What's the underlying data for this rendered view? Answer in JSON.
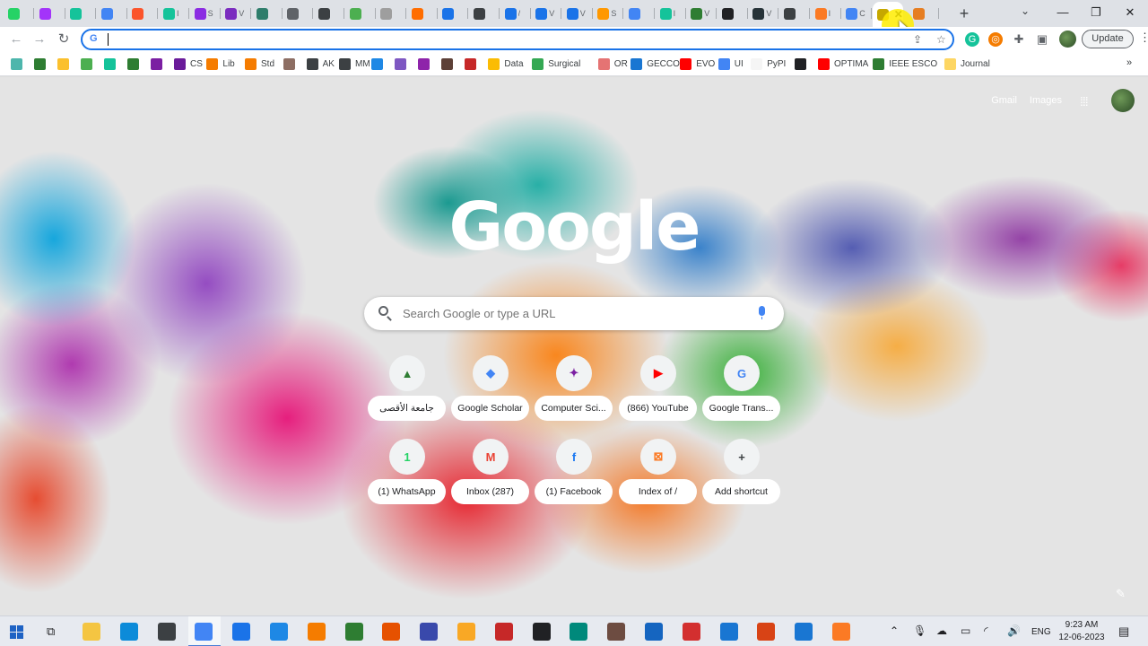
{
  "tabs": [
    {
      "icon": "whatsapp-icon",
      "label": "",
      "color": "#25d366"
    },
    {
      "icon": "messenger-icon",
      "label": "",
      "color": "#a334fa"
    },
    {
      "icon": "grammarly-icon",
      "label": "",
      "color": "#15c39a"
    },
    {
      "icon": "translate-icon",
      "label": "",
      "color": "#4285f4"
    },
    {
      "icon": "brave-icon",
      "label": "",
      "color": "#fb542b"
    },
    {
      "icon": "grammarly-icon",
      "label": "I",
      "color": "#15c39a"
    },
    {
      "icon": "p-icon",
      "label": "S",
      "color": "#8a2be2"
    },
    {
      "icon": "w-icon",
      "label": "V",
      "color": "#7a2cbf"
    },
    {
      "icon": "music-icon",
      "label": "",
      "color": "#2e7d6b"
    },
    {
      "icon": "arrow-icon",
      "label": "",
      "color": "#5f6368"
    },
    {
      "icon": "tool-icon",
      "label": "",
      "color": "#3c4043"
    },
    {
      "icon": "leaf-icon",
      "label": "",
      "color": "#4caf50"
    },
    {
      "icon": "e-icon",
      "label": "",
      "color": "#9e9e9e"
    },
    {
      "icon": "orange-icon",
      "label": "",
      "color": "#ff6d00"
    },
    {
      "icon": "doc-icon",
      "label": "",
      "color": "#1a73e8"
    },
    {
      "icon": "github-icon",
      "label": "",
      "color": "#3c4043"
    },
    {
      "icon": "copyright-icon",
      "label": "/",
      "color": "#1a73e8"
    },
    {
      "icon": "robot-icon",
      "label": "V",
      "color": "#1a73e8"
    },
    {
      "icon": "robot-icon",
      "label": "V",
      "color": "#1a73e8"
    },
    {
      "icon": "fish-icon",
      "label": "S",
      "color": "#ff9800"
    },
    {
      "icon": "google-icon",
      "label": "",
      "color": "#4285f4"
    },
    {
      "icon": "grammarly-icon",
      "label": "I",
      "color": "#15c39a"
    },
    {
      "icon": "w-icon",
      "label": "V",
      "color": "#2e7d32"
    },
    {
      "icon": "dark-icon",
      "label": "",
      "color": "#202124"
    },
    {
      "icon": "n-icon",
      "label": "V",
      "color": "#263238"
    },
    {
      "icon": "github-icon",
      "label": "",
      "color": "#3c4043"
    },
    {
      "icon": "xampp-icon",
      "label": "I",
      "color": "#fb7a24"
    },
    {
      "icon": "google-icon",
      "label": "C",
      "color": "#4285f4"
    },
    {
      "icon": "n-icon",
      "label": "",
      "color": "#c6a800",
      "active": true
    },
    {
      "icon": "mountain-icon",
      "label": "",
      "color": "#e67e22"
    }
  ],
  "toolbar": {
    "omnibox_value": "",
    "update_label": "Update"
  },
  "bookmarks": [
    {
      "label": "",
      "icon": "clock-icon",
      "color": "#4db6ac"
    },
    {
      "label": "",
      "icon": "leaf-icon",
      "color": "#2e7d32"
    },
    {
      "label": "",
      "icon": "note-icon",
      "color": "#fbc02d"
    },
    {
      "label": "",
      "icon": "book-icon",
      "color": "#4caf50"
    },
    {
      "label": "",
      "icon": "grammarly-icon",
      "color": "#15c39a"
    },
    {
      "label": "",
      "icon": "android-icon",
      "color": "#2e7d32"
    },
    {
      "label": "",
      "icon": "maple-icon",
      "color": "#7b1fa2"
    },
    {
      "label": "CS",
      "icon": "maple-icon",
      "color": "#6a1b9a"
    },
    {
      "label": "Lib",
      "icon": "grid-icon",
      "color": "#f57c00"
    },
    {
      "label": "Std",
      "icon": "grid-icon",
      "color": "#f57c00"
    },
    {
      "label": "",
      "icon": "brown-icon",
      "color": "#8d6e63"
    },
    {
      "label": "AK",
      "icon": "globe-icon",
      "color": "#3c4043"
    },
    {
      "label": "MM",
      "icon": "globe-icon",
      "color": "#3c4043"
    },
    {
      "label": "",
      "icon": "shield-icon",
      "color": "#1e88e5"
    },
    {
      "label": "",
      "icon": "sparkle-icon",
      "color": "#7e57c2"
    },
    {
      "label": "",
      "icon": "discord-icon",
      "color": "#8e24aa"
    },
    {
      "label": "",
      "icon": "photo-icon",
      "color": "#5d4037"
    },
    {
      "label": "",
      "icon": "scihub-icon",
      "color": "#c62828"
    },
    {
      "label": "Data",
      "icon": "drive-icon",
      "color": "#fbbc04"
    },
    {
      "label": "Surgical",
      "icon": "drive-icon",
      "color": "#34a853"
    },
    {
      "label": "OR",
      "icon": "gear-icon",
      "color": "#e57373"
    },
    {
      "label": "GECCO",
      "icon": "w-icon",
      "color": "#1976d2"
    },
    {
      "label": "EVO",
      "icon": "youtube-icon",
      "color": "#ff0000"
    },
    {
      "label": "UI",
      "icon": "doc-icon",
      "color": "#4285f4"
    },
    {
      "label": "PyPI",
      "icon": "pypi-icon",
      "color": "#f5f5f5"
    },
    {
      "label": "",
      "icon": "jc-icon",
      "color": "#202124"
    },
    {
      "label": "OPTIMA",
      "icon": "youtube-icon",
      "color": "#ff0000"
    },
    {
      "label": "IEEE ESCO",
      "icon": "ieee-icon",
      "color": "#2e7d32"
    },
    {
      "label": "Journal",
      "icon": "folder-icon",
      "color": "#fdd663"
    }
  ],
  "ntp": {
    "gmail": "Gmail",
    "images": "Images",
    "logo": "Google",
    "search_placeholder": "Search Google or type a URL",
    "shortcuts": [
      {
        "label": "جامعة الأقصى",
        "icon": "university-icon",
        "glyph": "▲",
        "color": "#2e7d32"
      },
      {
        "label": "Google Scholar",
        "icon": "scholar-icon",
        "glyph": "◆",
        "color": "#4285f4"
      },
      {
        "label": "Computer Sci...",
        "icon": "maple-icon",
        "glyph": "✦",
        "color": "#7b1fa2"
      },
      {
        "label": "(866) YouTube",
        "icon": "youtube-icon",
        "glyph": "▶",
        "color": "#ff0000"
      },
      {
        "label": "Google Trans...",
        "icon": "translate-icon",
        "glyph": "G",
        "color": "#4285f4"
      },
      {
        "label": "(1) WhatsApp",
        "icon": "whatsapp-icon",
        "glyph": "1",
        "color": "#25d366"
      },
      {
        "label": "Inbox (287)",
        "icon": "gmail-icon",
        "glyph": "M",
        "color": "#ea4335"
      },
      {
        "label": "(1) Facebook",
        "icon": "facebook-icon",
        "glyph": "f",
        "color": "#1877f2"
      },
      {
        "label": "Index of /",
        "icon": "xampp-icon",
        "glyph": "⊠",
        "color": "#fb7a24"
      },
      {
        "label": "Add shortcut",
        "icon": "plus-icon",
        "glyph": "+",
        "color": "#3c4043"
      }
    ]
  },
  "taskbar": {
    "apps": [
      {
        "icon": "file-explorer-icon",
        "color": "#f4c542"
      },
      {
        "icon": "edge-icon",
        "color": "#0c8bd9"
      },
      {
        "icon": "store-icon",
        "color": "#3c4043"
      },
      {
        "icon": "chrome-icon",
        "color": "#4285f4",
        "active": true
      },
      {
        "icon": "mail-icon",
        "color": "#1a73e8"
      },
      {
        "icon": "l-app-icon",
        "color": "#1e88e5"
      },
      {
        "icon": "orange-ring-icon",
        "color": "#f57c00"
      },
      {
        "icon": "green-ring-icon",
        "color": "#2e7d32"
      },
      {
        "icon": "matlab-icon",
        "color": "#e65100"
      },
      {
        "icon": "disk-icon",
        "color": "#3949ab"
      },
      {
        "icon": "cube-icon",
        "color": "#f9a825"
      },
      {
        "icon": "dots-icon",
        "color": "#c62828"
      },
      {
        "icon": "en-icon",
        "color": "#202124"
      },
      {
        "icon": "tree-icon",
        "color": "#00897b"
      },
      {
        "icon": "sheet-icon",
        "color": "#6d4c41"
      },
      {
        "icon": "book-icon",
        "color": "#1565c0"
      },
      {
        "icon": "acrobat-icon",
        "color": "#d32f2f"
      },
      {
        "icon": "note-icon",
        "color": "#1976d2"
      },
      {
        "icon": "powerpoint-icon",
        "color": "#d84315"
      },
      {
        "icon": "vscode-icon",
        "color": "#1976d2"
      },
      {
        "icon": "xampp-icon",
        "color": "#fb7a24"
      }
    ],
    "lang": "ENG",
    "time": "9:23 AM",
    "date": "12-06-2023"
  }
}
